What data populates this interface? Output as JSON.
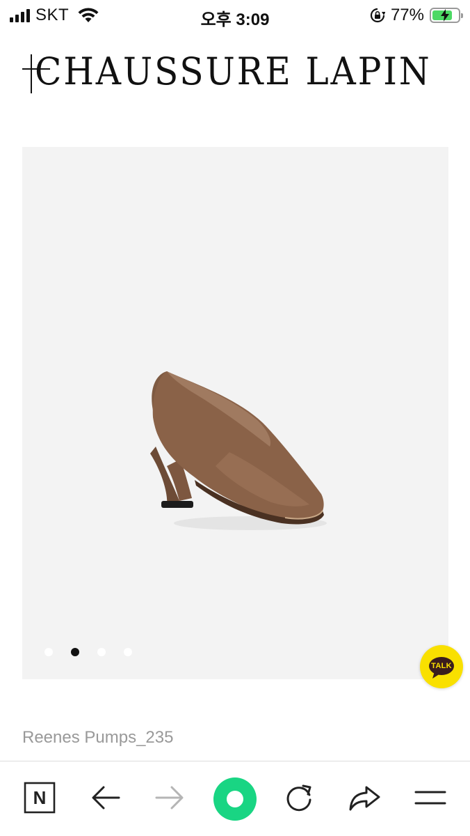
{
  "status_bar": {
    "carrier": "SKT",
    "time": "오후 3:09",
    "battery_percent": "77%",
    "battery_level": 0.77,
    "icons": [
      "signal-icon",
      "wifi-icon",
      "rotation-lock-icon",
      "battery-charging-icon"
    ]
  },
  "logo": {
    "text": "CHAUSSURE LAPIN"
  },
  "product_gallery": {
    "slide_count": 4,
    "active_index": 1,
    "image_subject": "brown-leather-pump-icon"
  },
  "chat_button": {
    "label": "TALK",
    "icon": "kakaotalk-icon",
    "color": "#f9e000"
  },
  "product": {
    "name": "Reenes Pumps_235"
  },
  "toolbar": {
    "icons": [
      "naver-icon",
      "back-arrow-icon",
      "forward-arrow-icon",
      "home-icon",
      "reload-icon",
      "share-icon",
      "menu-icon"
    ],
    "naver_letter": "N",
    "home_color": "#19d583"
  }
}
